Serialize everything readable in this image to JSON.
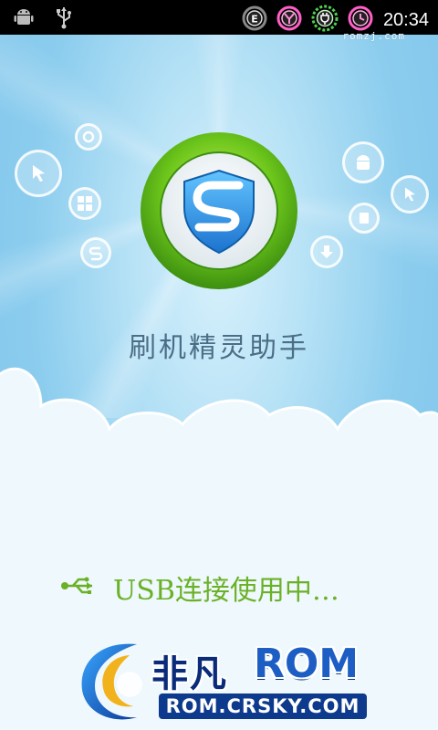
{
  "status_bar": {
    "left_icons": [
      "android-icon",
      "usb-icon"
    ],
    "right_icons": [
      "e-network-icon",
      "signal-icon",
      "battery-charging-icon",
      "alarm-clock-icon"
    ],
    "time": "20:34",
    "watermark": "romzj.com"
  },
  "splash": {
    "app_title": "刷机精灵助手",
    "usb_status": "USB连接使用中…",
    "usb_color": "#6bb126",
    "logo_letter": "S"
  },
  "brand": {
    "name_cn": "非凡",
    "name_rom": "ROM",
    "url": "ROM.CRSKY.COM"
  },
  "colors": {
    "sky": "#8ccdee",
    "logo_ring": "#66c21a",
    "shield": "#2f97e4",
    "title_text": "#4b6e86"
  }
}
